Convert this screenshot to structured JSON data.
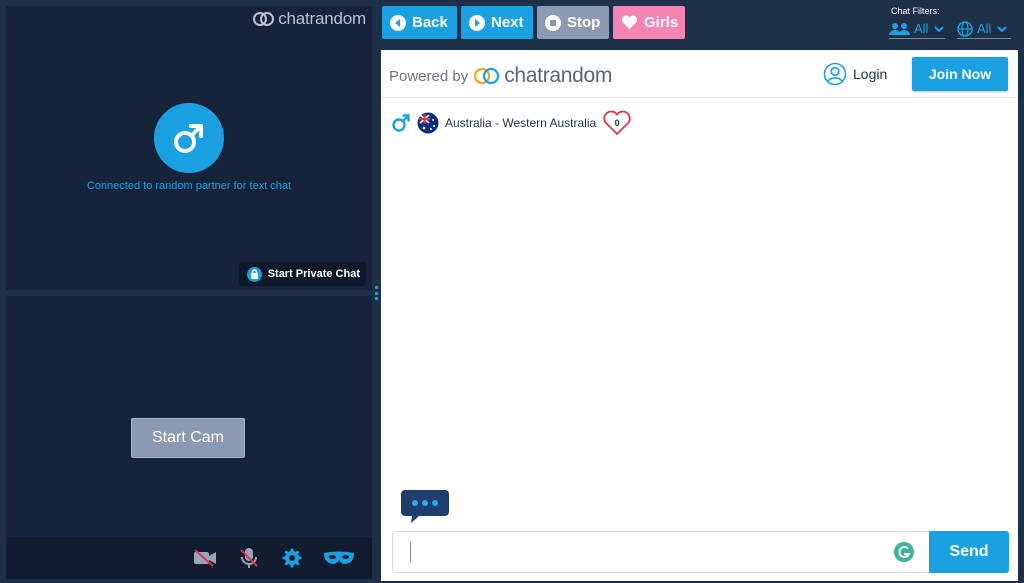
{
  "left": {
    "top": {
      "logo_text": "chatrandom",
      "status_text": "Connected to random partner for text chat",
      "private_chat_label": "Start Private Chat"
    },
    "bottom": {
      "start_cam_label": "Start Cam"
    }
  },
  "toolbar": {
    "back_label": "Back",
    "next_label": "Next",
    "stop_label": "Stop",
    "girls_label": "Girls",
    "filters_label": "Chat Filters:",
    "filter_gender_value": "All",
    "filter_country_value": "All"
  },
  "chat": {
    "powered_by": "Powered by",
    "brand": "chatrandom",
    "login_label": "Login",
    "join_label": "Join Now",
    "partner_location": "Australia - Western Australia",
    "like_count": "0",
    "message_placeholder": "",
    "send_label": "Send"
  },
  "colors": {
    "accent": "#1ba1e2",
    "background": "#1e3047",
    "video_bg": "#15243a",
    "girls_pink": "#f285b2",
    "stop_gray": "#8a9ab0",
    "heart_red": "#e0334f"
  },
  "icons": {
    "gender": "male-symbol-icon",
    "flag": "australia-flag-icon",
    "lock": "lock-icon",
    "camera_off": "camera-off-icon",
    "mic_off": "mic-off-icon",
    "settings": "gear-icon",
    "mask": "mask-icon",
    "user": "user-circle-icon",
    "typing": "typing-bubble-icon"
  }
}
